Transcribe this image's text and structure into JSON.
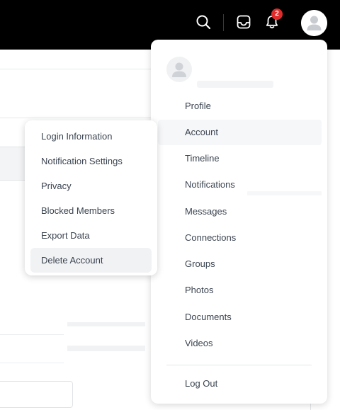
{
  "topbar": {
    "notification_count": "2",
    "icons": [
      "search-icon",
      "inbox-icon",
      "bell-icon",
      "user-avatar"
    ]
  },
  "dropdown": {
    "items": [
      {
        "label": "Profile"
      },
      {
        "label": "Account"
      },
      {
        "label": "Timeline"
      },
      {
        "label": "Notifications"
      },
      {
        "label": "Messages"
      },
      {
        "label": "Connections"
      },
      {
        "label": "Groups"
      },
      {
        "label": "Photos"
      },
      {
        "label": "Documents"
      },
      {
        "label": "Videos"
      }
    ],
    "logout_label": "Log Out",
    "active_item": "Account"
  },
  "submenu": {
    "items": [
      {
        "label": "Login Information"
      },
      {
        "label": "Notification Settings"
      },
      {
        "label": "Privacy"
      },
      {
        "label": "Blocked Members"
      },
      {
        "label": "Export Data"
      },
      {
        "label": "Delete Account"
      }
    ],
    "highlighted_item": "Delete Account"
  },
  "colors": {
    "topbar_bg": "#000000",
    "badge": "#e02b2b",
    "text": "#3b4450",
    "hover_bg": "#f1f2f4"
  }
}
